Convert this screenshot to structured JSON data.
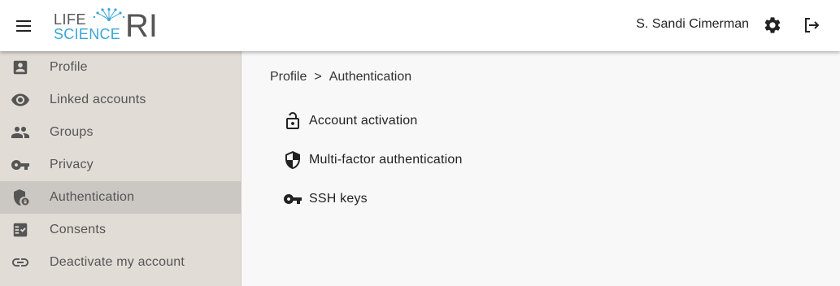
{
  "header": {
    "logo_line1": "LIFE",
    "logo_line2": "SCIENCE",
    "logo_ri": "RI",
    "user_name": "S. Sandi Cimerman",
    "icons": [
      "menu-icon",
      "gear-icon",
      "logout-icon"
    ]
  },
  "sidebar": {
    "items": [
      {
        "label": "Profile",
        "icon": "account-box-icon"
      },
      {
        "label": "Linked accounts",
        "icon": "eye-icon"
      },
      {
        "label": "Groups",
        "icon": "people-icon"
      },
      {
        "label": "Privacy",
        "icon": "key-icon"
      },
      {
        "label": "Authentication",
        "icon": "shield-lock-icon",
        "active": true
      },
      {
        "label": "Consents",
        "icon": "checklist-icon"
      },
      {
        "label": "Deactivate my account",
        "icon": "link-icon"
      }
    ]
  },
  "breadcrumb": {
    "items": [
      "Profile",
      "Authentication"
    ],
    "separator": ">"
  },
  "main": {
    "items": [
      {
        "label": "Account activation",
        "icon": "lock-open-icon"
      },
      {
        "label": "Multi-factor authentication",
        "icon": "shield-icon"
      },
      {
        "label": "SSH keys",
        "icon": "key-icon"
      }
    ]
  },
  "colors": {
    "sidebar_bg": "#e1dcd6",
    "sidebar_active": "#cbc7c2",
    "logo_blue": "#3aa6d9",
    "content_bg": "#f8f8f8"
  }
}
